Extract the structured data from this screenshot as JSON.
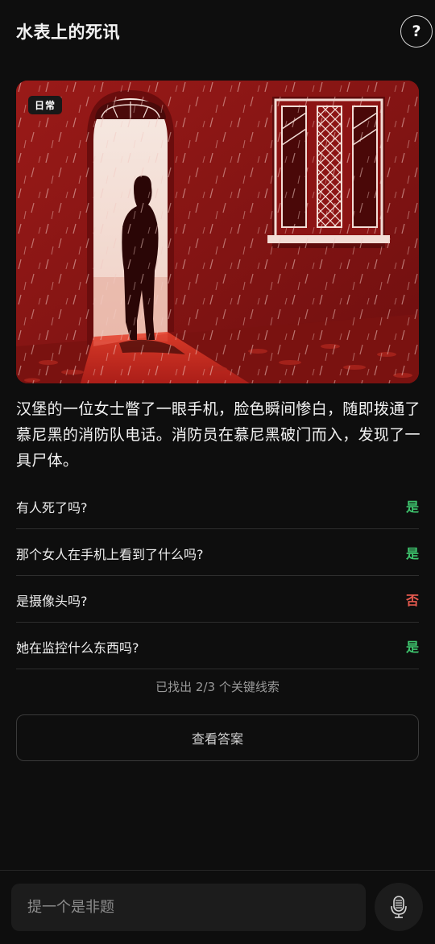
{
  "header": {
    "title": "水表上的死讯",
    "help_label": "?"
  },
  "hero": {
    "tag": "日常"
  },
  "story": "汉堡的一位女士瞥了一眼手机，脸色瞬间惨白，随即拨通了慕尼黑的消防队电话。消防员在慕尼黑破门而入，发现了一具尸体。",
  "questions": [
    {
      "question": "有人死了吗?",
      "answer": "是",
      "answer_color": "#3ec46d"
    },
    {
      "question": "那个女人在手机上看到了什么吗?",
      "answer": "是",
      "answer_color": "#3ec46d"
    },
    {
      "question": "是摄像头吗?",
      "answer": "否",
      "answer_color": "#e65a4f"
    },
    {
      "question": "她在监控什么东西吗?",
      "answer": "是",
      "answer_color": "#3ec46d"
    }
  ],
  "progress_text": "已找出 2/3 个关键线索",
  "answer_button": "查看答案",
  "input": {
    "placeholder": "提一个是非题"
  },
  "icons": {
    "help": "question-icon",
    "mic": "microphone-icon"
  },
  "colors": {
    "background": "#0e0e0e",
    "yes": "#3ec46d",
    "no": "#e65a4f",
    "illustration": "#8c1414"
  }
}
